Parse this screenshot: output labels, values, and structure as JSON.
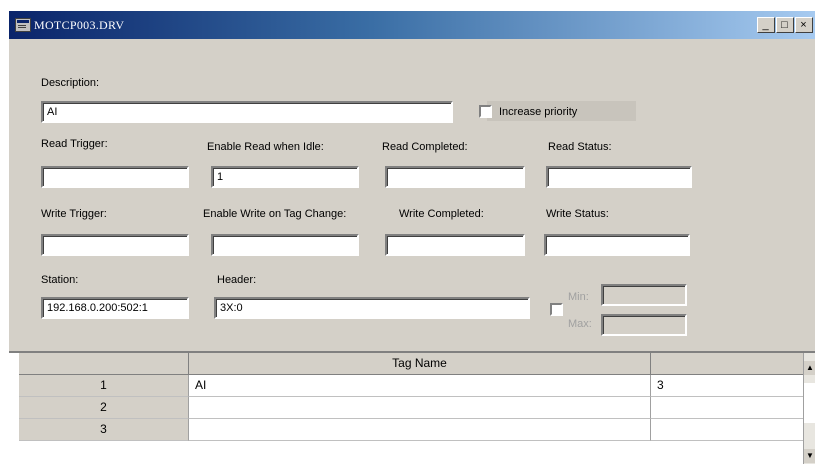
{
  "window": {
    "title": "MOTCP003.DRV",
    "minimize": "_",
    "maximize": "□",
    "close": "×"
  },
  "form": {
    "description_label": "Description:",
    "description_value": "AI",
    "increase_priority_label": "Increase priority",
    "increase_priority_checked": false,
    "read_trigger_label": "Read Trigger:",
    "read_trigger_value": "",
    "enable_read_label": "Enable Read when Idle:",
    "enable_read_value": "1",
    "read_completed_label": "Read Completed:",
    "read_completed_value": "",
    "read_status_label": "Read Status:",
    "read_status_value": "",
    "write_trigger_label": "Write Trigger:",
    "write_trigger_value": "",
    "enable_write_label": "Enable Write on Tag Change:",
    "enable_write_value": "",
    "write_completed_label": "Write Completed:",
    "write_completed_value": "",
    "write_status_label": "Write Status:",
    "write_status_value": "",
    "station_label": "Station:",
    "station_value": "192.168.0.200:502:1",
    "header_label": "Header:",
    "header_value": "3X:0",
    "min_label": "Min:",
    "max_label": "Max:",
    "min_value": "",
    "max_value": ""
  },
  "grid": {
    "columns": [
      "",
      "Tag Name",
      ""
    ],
    "rows": [
      {
        "num": "1",
        "tag": "AI",
        "address": "3"
      },
      {
        "num": "2",
        "tag": "",
        "address": ""
      },
      {
        "num": "3",
        "tag": "",
        "address": ""
      }
    ]
  }
}
